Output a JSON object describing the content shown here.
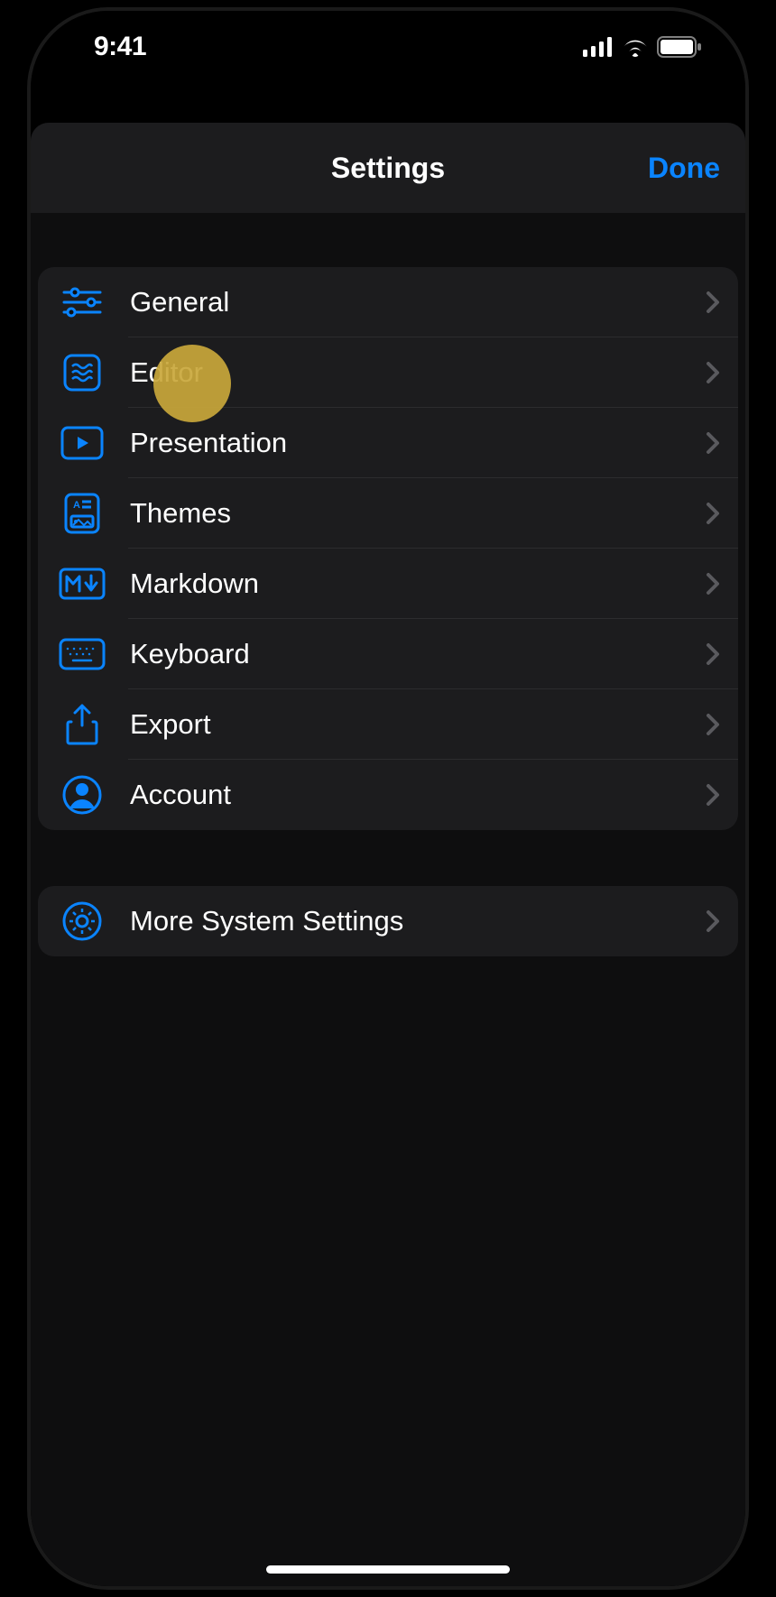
{
  "statusBar": {
    "time": "9:41"
  },
  "nav": {
    "title": "Settings",
    "done": "Done"
  },
  "groups": [
    {
      "items": [
        {
          "icon": "sliders",
          "label": "General",
          "name": "general"
        },
        {
          "icon": "editor",
          "label": "Editor",
          "name": "editor"
        },
        {
          "icon": "play",
          "label": "Presentation",
          "name": "presentation"
        },
        {
          "icon": "themes",
          "label": "Themes",
          "name": "themes"
        },
        {
          "icon": "markdown",
          "label": "Markdown",
          "name": "markdown"
        },
        {
          "icon": "keyboard",
          "label": "Keyboard",
          "name": "keyboard"
        },
        {
          "icon": "export",
          "label": "Export",
          "name": "export"
        },
        {
          "icon": "account",
          "label": "Account",
          "name": "account"
        }
      ]
    },
    {
      "items": [
        {
          "icon": "gear",
          "label": "More System Settings",
          "name": "more-system-settings"
        }
      ]
    }
  ],
  "colors": {
    "accent": "#0a84ff",
    "highlight": "#c9a73b"
  }
}
